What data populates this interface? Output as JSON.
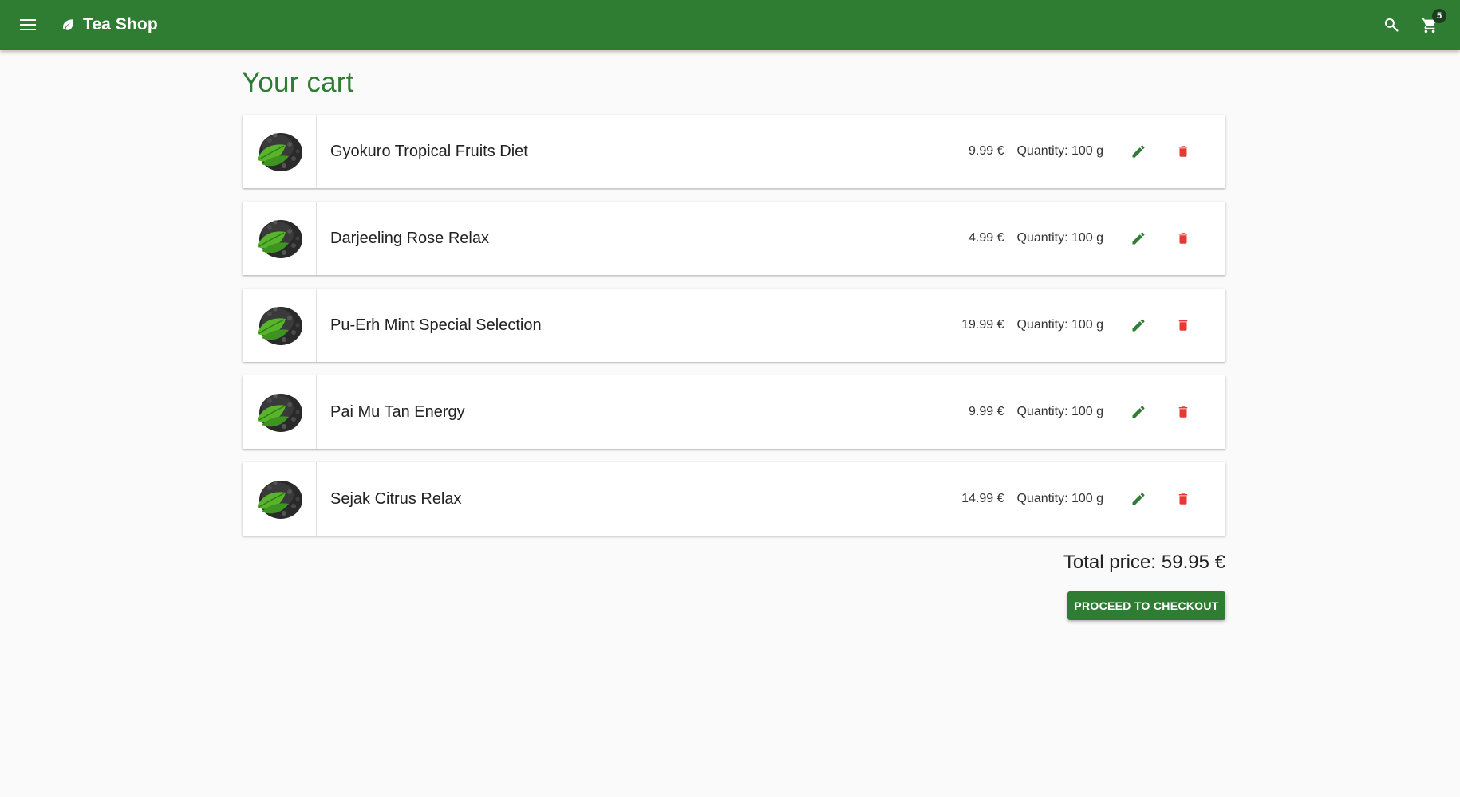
{
  "header": {
    "menu_icon": "menu-icon",
    "brand_icon": "leaf-icon",
    "title": "Tea Shop",
    "search_icon": "search-icon",
    "cart_icon": "cart-icon",
    "cart_count": "5"
  },
  "page": {
    "title": "Your cart"
  },
  "cart": {
    "items": [
      {
        "name": "Gyokuro Tropical Fruits Diet",
        "price": "9.99 €",
        "quantity": "Quantity: 100 g"
      },
      {
        "name": "Darjeeling Rose Relax",
        "price": "4.99 €",
        "quantity": "Quantity: 100 g"
      },
      {
        "name": "Pu-Erh Mint Special Selection",
        "price": "19.99 €",
        "quantity": "Quantity: 100 g"
      },
      {
        "name": "Pai Mu Tan Energy",
        "price": "9.99 €",
        "quantity": "Quantity: 100 g"
      },
      {
        "name": "Sejak Citrus Relax",
        "price": "14.99 €",
        "quantity": "Quantity: 100 g"
      }
    ],
    "item_icons": {
      "edit": "pencil-icon",
      "delete": "trash-icon",
      "thumbnail": "tea-leaves-image"
    }
  },
  "summary": {
    "total_label": "Total price:",
    "total_value": "59.95 €",
    "checkout_label": "PROCEED TO CHECKOUT"
  },
  "colors": {
    "primary": "#2e7d32",
    "delete": "#e53935",
    "background": "#fafafa"
  }
}
